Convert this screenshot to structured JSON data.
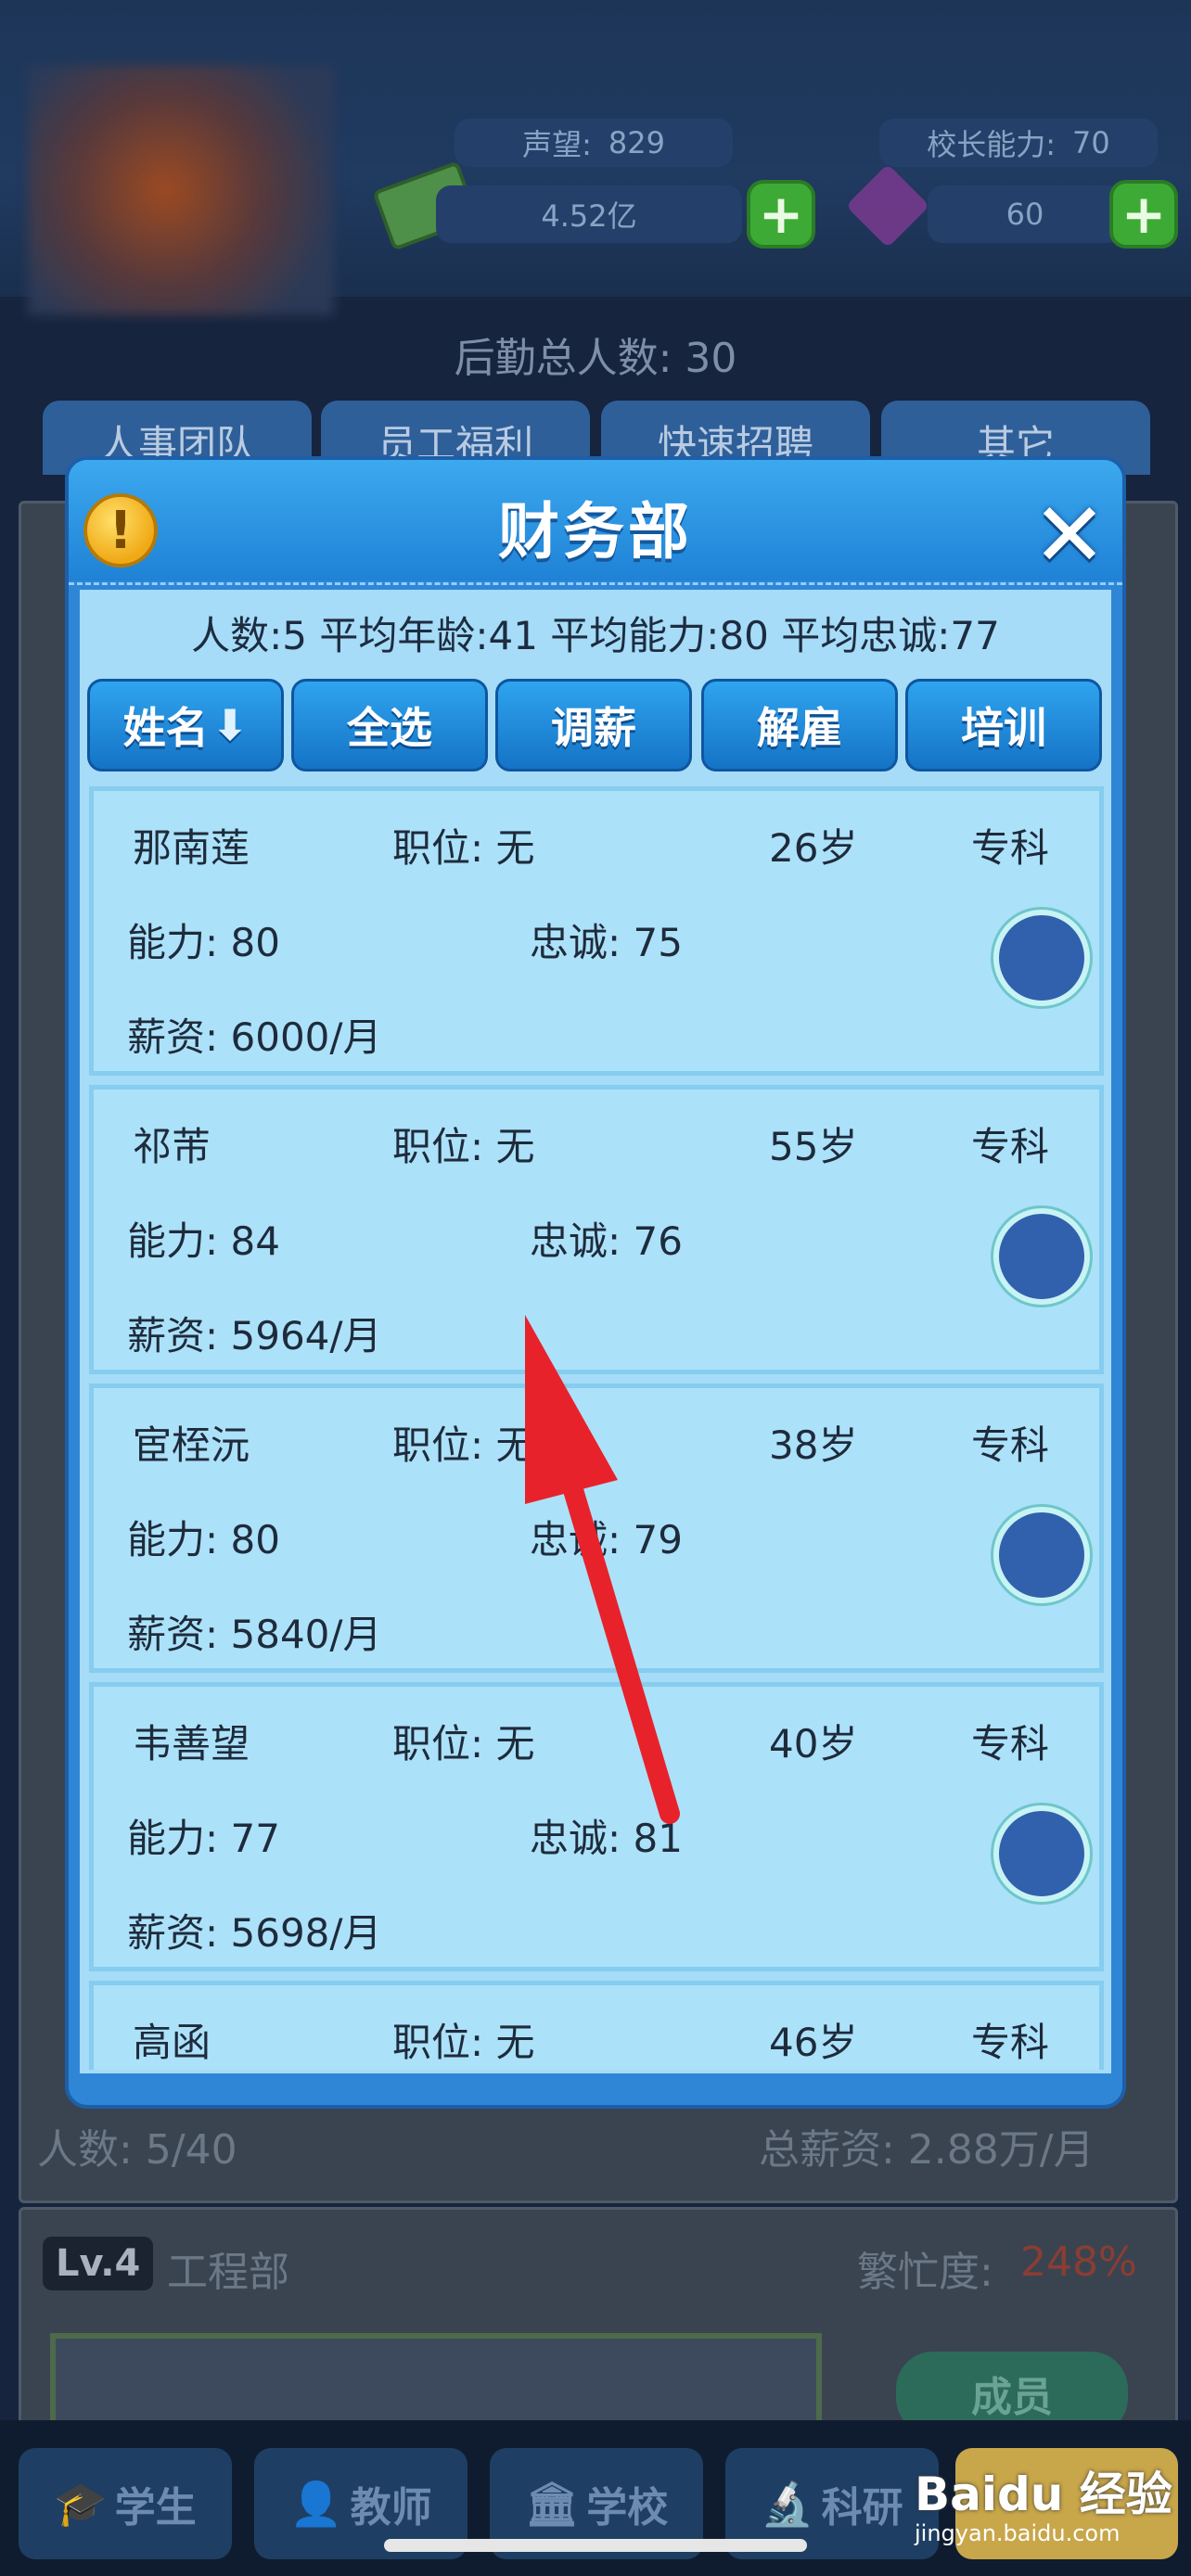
{
  "hud": {
    "reputation_label": "声望:",
    "reputation_value": "829",
    "principal_label": "校长能力:",
    "principal_value": "70",
    "money": "4.52亿",
    "gems": "60"
  },
  "background": {
    "logistics_total": "后勤总人数: 30",
    "tabs": [
      "人事团队",
      "员工福利",
      "快速招聘",
      "其它"
    ],
    "finance_footer_count": "人数: 5/40",
    "finance_footer_salary": "总薪资: 2.88万/月",
    "engineering_level": "Lv.4",
    "engineering_name": "工程部",
    "engineering_busy_label": "繁忙度:",
    "engineering_busy_value": "248%",
    "members_button": "成员"
  },
  "modal": {
    "title": "财务部",
    "stats": "人数:5 平均年龄:41 平均能力:80 平均忠诚:77",
    "buttons": [
      "姓名",
      "全选",
      "调薪",
      "解雇",
      "培训"
    ],
    "employees": [
      {
        "name": "那南莲",
        "position": "职位: 无",
        "age": "26岁",
        "edu": "专科",
        "ability": "能力: 80",
        "loyalty": "忠诚: 75",
        "salary": "薪资: 6000/月"
      },
      {
        "name": "祁芾",
        "position": "职位: 无",
        "age": "55岁",
        "edu": "专科",
        "ability": "能力: 84",
        "loyalty": "忠诚: 76",
        "salary": "薪资: 5964/月"
      },
      {
        "name": "宦桎沅",
        "position": "职位: 无",
        "age": "38岁",
        "edu": "专科",
        "ability": "能力: 80",
        "loyalty": "忠诚: 79",
        "salary": "薪资: 5840/月"
      },
      {
        "name": "韦善望",
        "position": "职位: 无",
        "age": "40岁",
        "edu": "专科",
        "ability": "能力: 77",
        "loyalty": "忠诚: 81",
        "salary": "薪资: 5698/月"
      },
      {
        "name": "高函",
        "position": "职位: 无",
        "age": "46岁",
        "edu": "专科",
        "ability": "",
        "loyalty": "",
        "salary": ""
      }
    ]
  },
  "nav": {
    "items": [
      "学生",
      "教师",
      "学校",
      "科研"
    ],
    "watermark": "Baidu 经验",
    "watermark_url": "jingyan.baidu.com"
  },
  "colors": {
    "annotation_arrow": "#e8222b",
    "accent": "#2f86d6"
  }
}
